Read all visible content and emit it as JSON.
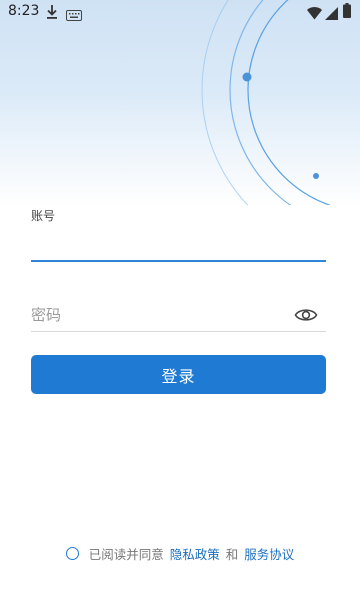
{
  "status_bar": {
    "time": "8:23",
    "icons": [
      "download-icon",
      "keyboard-icon",
      "wifi-icon",
      "signal-icon",
      "battery-icon"
    ]
  },
  "form": {
    "account_label": "账号",
    "account_value": "",
    "password_placeholder": "密码",
    "password_value": "",
    "login_label": "登录"
  },
  "agreement": {
    "checked": false,
    "prefix": "已阅读并同意",
    "privacy_link": "隐私政策",
    "conjunction": "和",
    "service_link": "服务协议"
  },
  "colors": {
    "accent": "#1f7ad3",
    "link": "#1f6fbd",
    "hero_top": "#cfe2f4"
  }
}
